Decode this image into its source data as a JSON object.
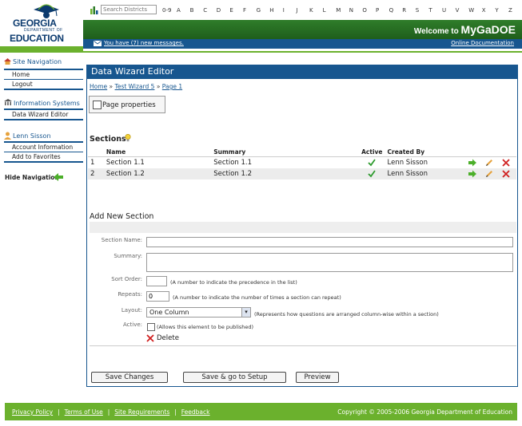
{
  "logo": {
    "line1": "GEORGIA",
    "line2": "DEPARTMENT OF",
    "line3": "EDUCATION"
  },
  "header": {
    "district_search_placeholder": "Search Districts",
    "digits": "0-9",
    "letters": [
      "A",
      "B",
      "C",
      "D",
      "E",
      "F",
      "G",
      "H",
      "I",
      "J",
      "K",
      "L",
      "M",
      "N",
      "O",
      "P",
      "Q",
      "R",
      "S",
      "T",
      "U",
      "V",
      "W",
      "X",
      "Y",
      "Z"
    ],
    "welcome_prefix": "Welcome to",
    "welcome_brand": "MyGaDOE",
    "messages_link": "You have (7) new messages.",
    "docs_link": "Online Documentation"
  },
  "sidebar": {
    "site_nav_title": "Site Navigation",
    "site_nav_items": [
      "Home",
      "Logout"
    ],
    "info_title": "Information Systems",
    "info_items": [
      "Data Wizard Editor"
    ],
    "user_title": "Lenn Sisson",
    "user_items": [
      "Account Information",
      "Add to Favorites"
    ],
    "hide_nav": "Hide Navigation"
  },
  "panel": {
    "title": "Data Wizard Editor",
    "breadcrumb": [
      "Home",
      "Test Wizard 5",
      "Page 1"
    ],
    "breadcrumb_sep": "»",
    "page_properties": "Page properties",
    "sections_title": "Sections",
    "columns": [
      "Name",
      "Summary",
      "Active",
      "Created By"
    ],
    "rows": [
      {
        "num": "1",
        "name": "Section 1.1",
        "summary": "Section 1.1",
        "created_by": "Lenn Sisson"
      },
      {
        "num": "2",
        "name": "Section 1.2",
        "summary": "Section 1.2",
        "created_by": "Lenn Sisson"
      }
    ],
    "add_title": "Add New Section"
  },
  "form": {
    "section_name_label": "Section Name:",
    "summary_label": "Summary:",
    "sort_order_label": "Sort Order:",
    "sort_order_note": "(A number to indicate the precedence in the list)",
    "repeats_label": "Repeats:",
    "repeats_value": "0",
    "repeats_note": "(A number to indicate the number of times a section can repeat)",
    "layout_label": "Layout:",
    "layout_value": "One Column",
    "layout_note": "(Represents how questions are arranged column-wise within a section)",
    "active_label": "Active:",
    "active_note": "(Allows this element to be published)",
    "delete_label": "Delete"
  },
  "buttons": {
    "save": "Save Changes",
    "save_setup": "Save & go to Setup",
    "preview": "Preview"
  },
  "footer": {
    "links": [
      "Privacy Policy",
      "Terms of Use",
      "Site Requirements",
      "Feedback"
    ],
    "separator": "|",
    "copyright": "Copyright © 2005-2006 Georgia Department of Education"
  },
  "colors": {
    "brand_blue": "#17568f",
    "brand_green": "#6bb12d",
    "welcome_green": "#2f7d2a"
  }
}
